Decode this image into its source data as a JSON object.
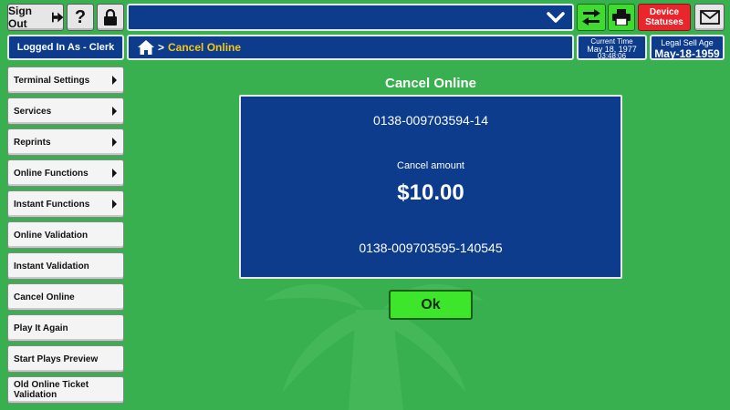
{
  "toolbar": {
    "signout_label": "Sign Out",
    "help_label": "?",
    "device_statuses_label": "Device Statuses"
  },
  "header": {
    "logged_in": "Logged In As - Clerk",
    "breadcrumb_current": "Cancel Online",
    "current_time_label": "Current Time",
    "current_date": "May 18, 1977",
    "current_clock": "03:48:06",
    "legal_sell_age_label": "Legal Sell Age",
    "legal_sell_age_date": "May-18-1959"
  },
  "sidebar": {
    "items": [
      {
        "label": "Terminal Settings",
        "has_submenu": true
      },
      {
        "label": "Services",
        "has_submenu": true
      },
      {
        "label": "Reprints",
        "has_submenu": true
      },
      {
        "label": "Online Functions",
        "has_submenu": true
      },
      {
        "label": "Instant Functions",
        "has_submenu": true
      },
      {
        "label": "Online Validation",
        "has_submenu": false
      },
      {
        "label": "Instant Validation",
        "has_submenu": false
      },
      {
        "label": "Cancel Online",
        "has_submenu": false
      },
      {
        "label": "Play It Again",
        "has_submenu": false
      },
      {
        "label": "Start Plays Preview",
        "has_submenu": false
      },
      {
        "label": "Old Online Ticket Validation",
        "has_submenu": false
      }
    ]
  },
  "main": {
    "title": "Cancel Online",
    "ticket_number": "0138-009703594-14",
    "cancel_amount_label": "Cancel amount",
    "cancel_amount": "$10.00",
    "cancel_serial": "0138-009703595-140545",
    "ok_label": "Ok"
  },
  "colors": {
    "background": "#38b04f",
    "panel": "#0d3c8c",
    "accent_green": "#3ddc2e",
    "alert_red": "#e8262c",
    "breadcrumb_yellow": "#f5c518"
  }
}
